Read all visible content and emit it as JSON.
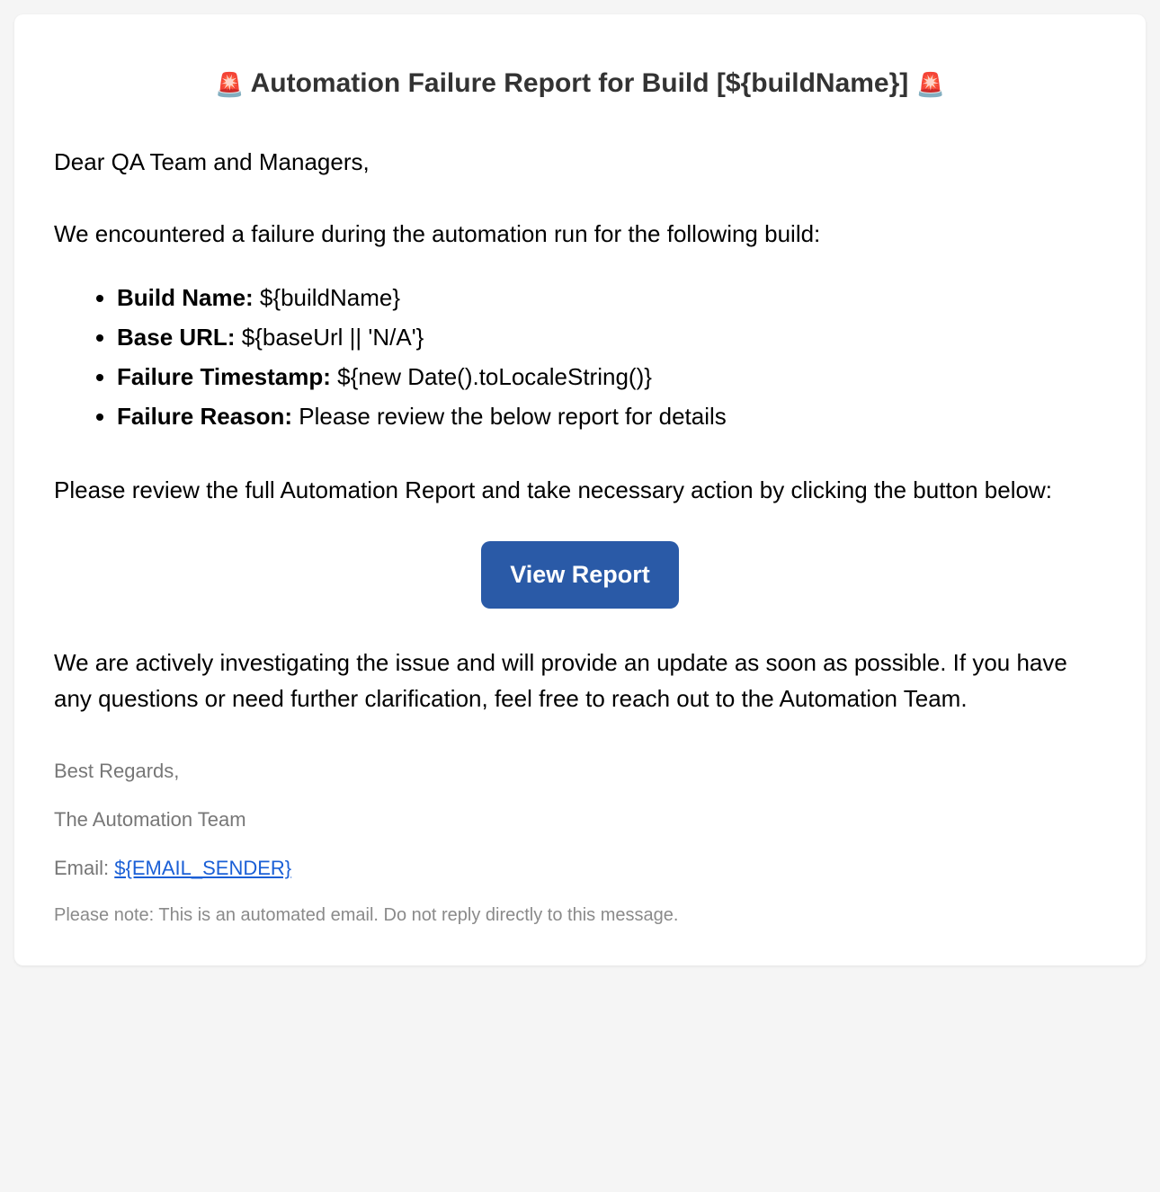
{
  "header": {
    "icon_left": "🚨",
    "title": "Automation Failure Report for Build [${buildName}]",
    "icon_right": "🚨"
  },
  "greeting": "Dear QA Team and Managers,",
  "intro": "We encountered a failure during the automation run for the following build:",
  "details": [
    {
      "label": "Build Name:",
      "value": "${buildName}"
    },
    {
      "label": "Base URL:",
      "value": "${baseUrl || 'N/A'}"
    },
    {
      "label": "Failure Timestamp:",
      "value": "${new Date().toLocaleString()}"
    },
    {
      "label": "Failure Reason:",
      "value": "Please review the below report for details"
    }
  ],
  "instruction": "Please review the full Automation Report and take necessary action by clicking the button below:",
  "button": {
    "label": "View Report"
  },
  "followup": "We are actively investigating the issue and will provide an update as soon as possible. If you have any questions or need further clarification, feel free to reach out to the Automation Team.",
  "footer": {
    "signoff": "Best Regards,",
    "team": "The Automation Team",
    "email_label": "Email: ",
    "email_value": "${EMAIL_SENDER}",
    "note": "Please note: This is an automated email. Do not reply directly to this message."
  }
}
